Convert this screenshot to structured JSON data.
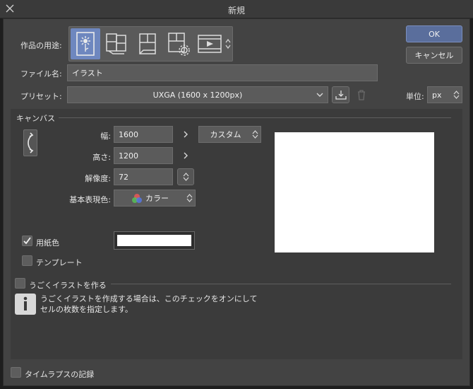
{
  "window": {
    "title": "新規"
  },
  "labels": {
    "purpose": "作品の用途:",
    "filename": "ファイル名:",
    "preset": "プリセット:",
    "unit": "単位:",
    "canvas_section": "キャンバス",
    "width": "幅:",
    "height": "高さ:",
    "resolution": "解像度:",
    "color_mode": "基本表現色:",
    "paper_color": "用紙色",
    "template": "テンプレート",
    "animated": "うごくイラストを作る",
    "timelapse": "タイムラプスの記録"
  },
  "buttons": {
    "ok": "OK",
    "cancel": "キャンセル"
  },
  "purposes": [
    {
      "name": "illustration",
      "selected": true
    },
    {
      "name": "comic"
    },
    {
      "name": "page"
    },
    {
      "name": "page-settings"
    },
    {
      "name": "animation"
    }
  ],
  "fields": {
    "filename": "イラスト",
    "preset": "UXGA (1600 x 1200px)",
    "unit": "px",
    "width": "1600",
    "height": "1200",
    "resolution": "72",
    "size_preset": "カスタム",
    "color_mode": "カラー"
  },
  "checkboxes": {
    "paper_color": true,
    "template": false,
    "animated": false,
    "timelapse": false
  },
  "info_text_line1": "うごくイラストを作成する場合は、このチェックをオンにして",
  "info_text_line2": "セルの枚数を指定します。",
  "colors": {
    "accent": "#6e87bf",
    "ok_button": "#5a6e9c",
    "paper": "#ffffff",
    "dialog_bg": "#434343"
  }
}
